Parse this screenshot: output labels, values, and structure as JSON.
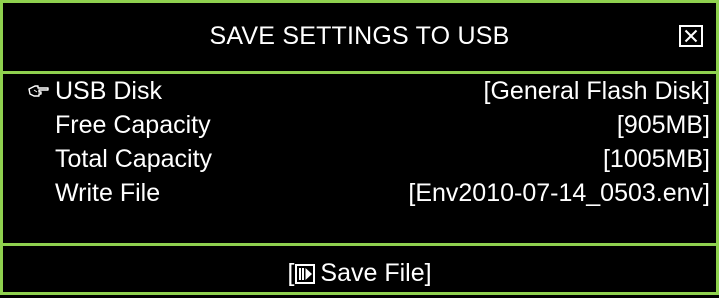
{
  "dialog": {
    "title": "SAVE SETTINGS TO USB",
    "close_icon": "close-box-icon",
    "accent_color": "#8fd14f"
  },
  "rows": [
    {
      "label": "USB Disk",
      "value": "[General Flash Disk]",
      "selected": true,
      "icon": "pointing-hand-icon"
    },
    {
      "label": "Free Capacity",
      "value": "[905MB]",
      "selected": false
    },
    {
      "label": "Total Capacity",
      "value": "[1005MB]",
      "selected": false
    },
    {
      "label": "Write File",
      "value": "[Env2010-07-14_0503.env]",
      "selected": false
    }
  ],
  "footer": {
    "bracket_open": "[",
    "button_icon": "play-icon",
    "button_label": "Save File]"
  }
}
